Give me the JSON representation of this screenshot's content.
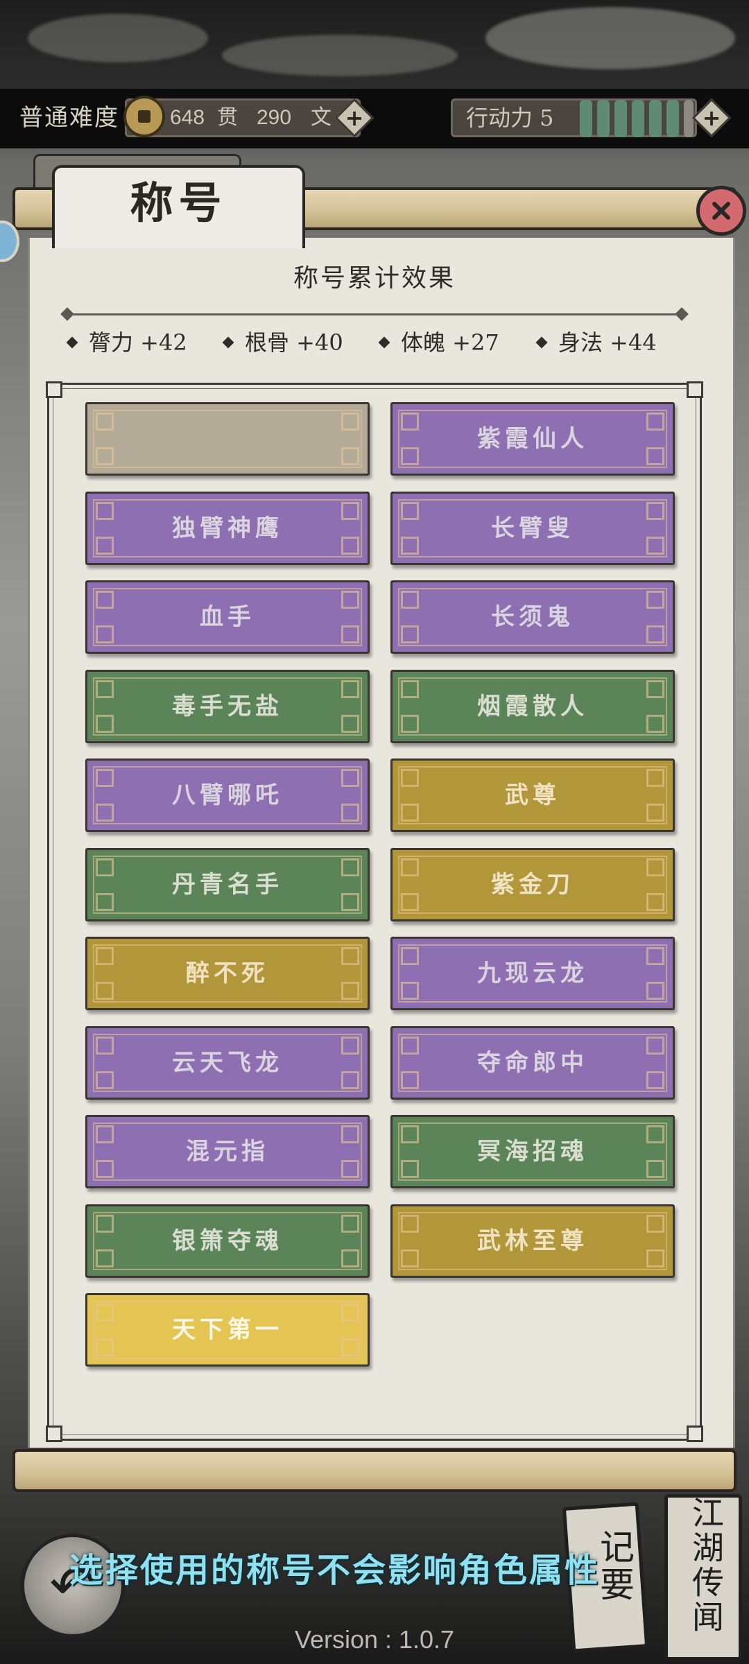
{
  "header": {
    "difficulty": "普通难度",
    "currency_guan": "648",
    "currency_guan_unit": "贯",
    "currency_wen": "290",
    "currency_wen_unit": "文",
    "action_points_label": "行动力 5",
    "action_pips_filled": 6,
    "action_pips_total": 7
  },
  "panel": {
    "tab_title": "称号",
    "section_title": "称号累计效果",
    "stats": [
      {
        "name": "膂力",
        "value": "+42",
        "text": "膂力 +42"
      },
      {
        "name": "根骨",
        "value": "+40",
        "text": "根骨 +40"
      },
      {
        "name": "体魄",
        "value": "+27",
        "text": "体魄 +27"
      },
      {
        "name": "身法",
        "value": "+44",
        "text": "身法 +44"
      }
    ],
    "titles": [
      {
        "label": "",
        "color": "grey"
      },
      {
        "label": "紫霞仙人",
        "color": "purple"
      },
      {
        "label": "独臂神鹰",
        "color": "purple"
      },
      {
        "label": "长臂叟",
        "color": "purple"
      },
      {
        "label": "血手",
        "color": "purple"
      },
      {
        "label": "长须鬼",
        "color": "purple"
      },
      {
        "label": "毒手无盐",
        "color": "green"
      },
      {
        "label": "烟霞散人",
        "color": "green"
      },
      {
        "label": "八臂哪吒",
        "color": "purple"
      },
      {
        "label": "武尊",
        "color": "gold"
      },
      {
        "label": "丹青名手",
        "color": "green"
      },
      {
        "label": "紫金刀",
        "color": "gold"
      },
      {
        "label": "醉不死",
        "color": "gold"
      },
      {
        "label": "九现云龙",
        "color": "purple"
      },
      {
        "label": "云天飞龙",
        "color": "purple"
      },
      {
        "label": "夺命郎中",
        "color": "purple"
      },
      {
        "label": "混元指",
        "color": "purple"
      },
      {
        "label": "冥海招魂",
        "color": "green"
      },
      {
        "label": "银箫夺魂",
        "color": "green"
      },
      {
        "label": "武林至尊",
        "color": "gold"
      },
      {
        "label": "天下第一",
        "color": "yellow"
      }
    ]
  },
  "footer": {
    "hint": "选择使用的称号不会影响角色属性",
    "card_left": "记要",
    "card_right": "江湖传闻",
    "version": "Version : 1.0.7"
  },
  "icons": {
    "close": "close-icon",
    "back": "back-arrow-icon",
    "coin": "coin-icon",
    "plus": "plus-icon"
  },
  "colors": {
    "purple": "#8e6fb1",
    "green": "#5c8459",
    "gold": "#b2973a",
    "yellow": "#e4c452",
    "grey": "#b3aa98",
    "hint_text": "#8fe0f0"
  }
}
